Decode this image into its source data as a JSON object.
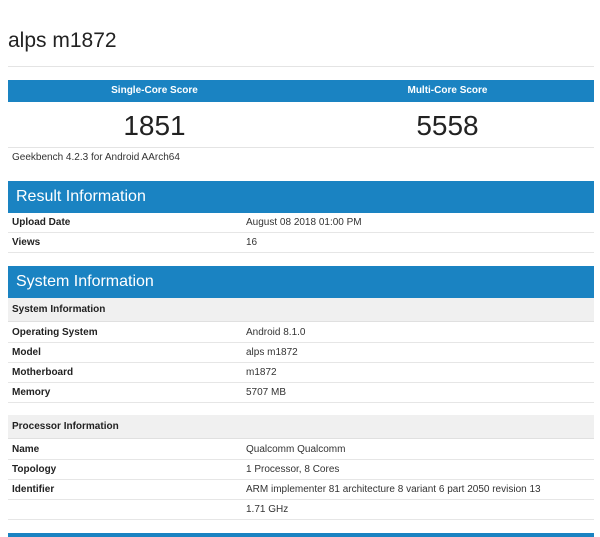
{
  "device_title": "alps m1872",
  "scores": {
    "single_label": "Single-Core Score",
    "multi_label": "Multi-Core Score",
    "single_value": "1851",
    "multi_value": "5558"
  },
  "geekbench_version": "Geekbench 4.2.3 for Android AArch64",
  "result_information": {
    "title": "Result Information",
    "rows": [
      {
        "key": "Upload Date",
        "value": "August 08 2018 01:00 PM"
      },
      {
        "key": "Views",
        "value": "16"
      }
    ]
  },
  "system_information": {
    "title": "System Information",
    "system_subheader": "System Information",
    "system_rows": [
      {
        "key": "Operating System",
        "value": "Android 8.1.0"
      },
      {
        "key": "Model",
        "value": "alps m1872"
      },
      {
        "key": "Motherboard",
        "value": "m1872"
      },
      {
        "key": "Memory",
        "value": "5707 MB"
      }
    ],
    "processor_subheader": "Processor Information",
    "processor_rows": [
      {
        "key": "Name",
        "value": "Qualcomm Qualcomm"
      },
      {
        "key": "Topology",
        "value": "1 Processor, 8 Cores"
      },
      {
        "key": "Identifier",
        "value": "ARM implementer 81 architecture 8 variant 6 part 2050 revision 13"
      },
      {
        "key": "",
        "value": "1.71 GHz"
      }
    ]
  },
  "colors": {
    "accent": "#1a83c2",
    "subheader_bg": "#f0f0f0"
  }
}
